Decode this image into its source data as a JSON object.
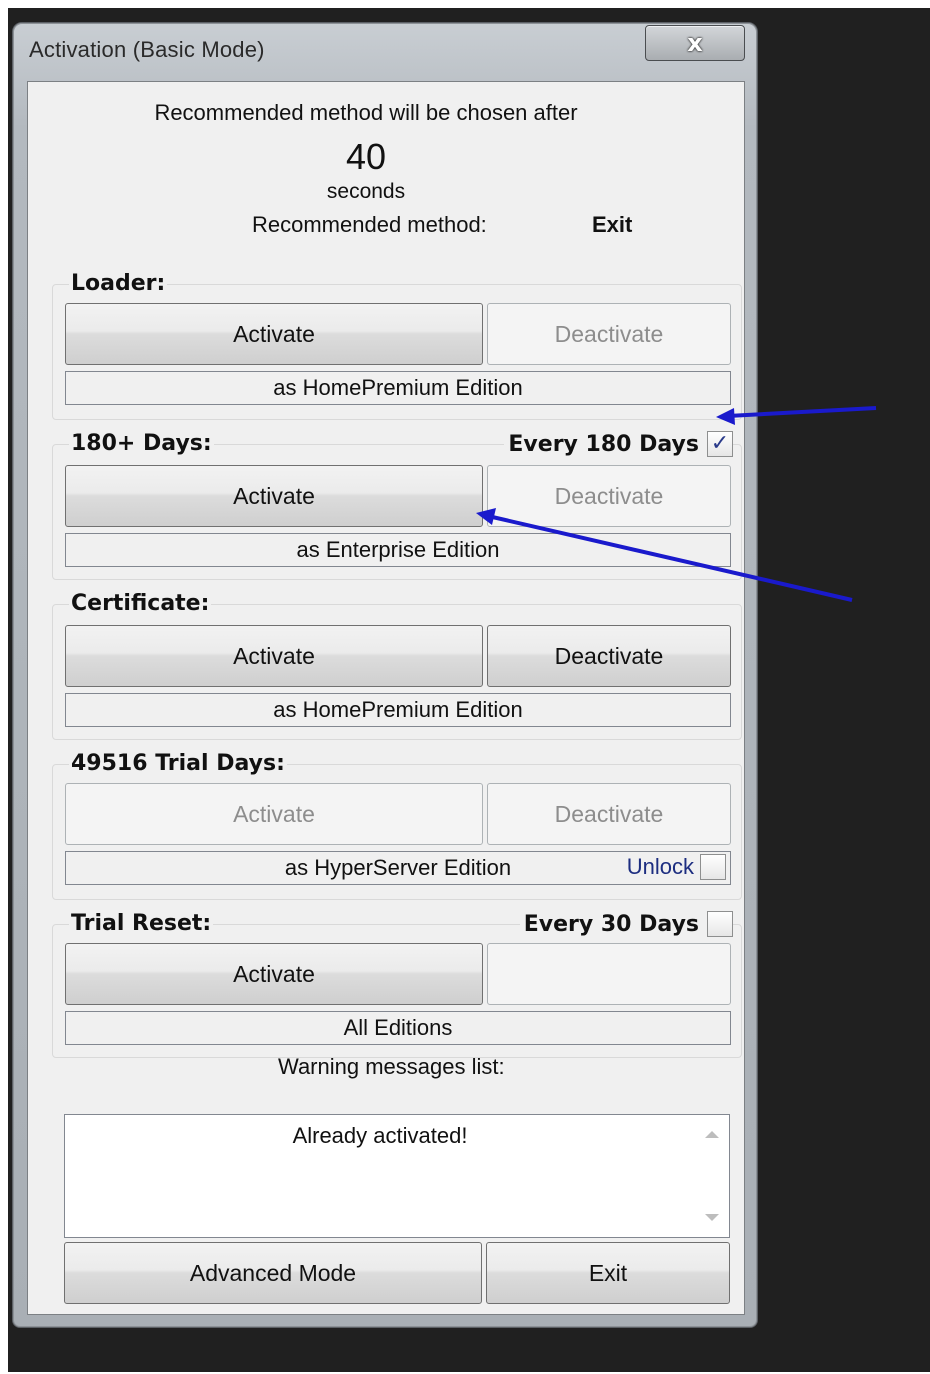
{
  "window": {
    "title": "Activation (Basic Mode)",
    "close_glyph": "x"
  },
  "header": {
    "recommend_text": "Recommended method will be chosen after",
    "countdown": "40",
    "countdown_unit": "seconds",
    "recommended_label": "Recommended method:",
    "recommended_value": "Exit"
  },
  "groups": [
    {
      "title": "Loader:",
      "activate_label": "Activate",
      "activate_enabled": true,
      "deactivate_label": "Deactivate",
      "deactivate_enabled": false,
      "edition": "as HomePremium Edition"
    },
    {
      "title": "180+ Days:",
      "option_label": "Every 180 Days",
      "option_checked": true,
      "activate_label": "Activate",
      "activate_enabled": true,
      "deactivate_label": "Deactivate",
      "deactivate_enabled": false,
      "edition": "as Enterprise Edition"
    },
    {
      "title": "Certificate:",
      "activate_label": "Activate",
      "activate_enabled": true,
      "deactivate_label": "Deactivate",
      "deactivate_enabled": true,
      "edition": "as HomePremium Edition"
    },
    {
      "title": "49516 Trial Days:",
      "activate_label": "Activate",
      "activate_enabled": false,
      "deactivate_label": "Deactivate",
      "deactivate_enabled": false,
      "edition": "as HyperServer Edition",
      "unlock_label": "Unlock",
      "unlock_checked": false
    },
    {
      "title": "Trial Reset:",
      "option_label": "Every 30 Days",
      "option_checked": false,
      "activate_label": "Activate",
      "activate_enabled": true,
      "deactivate_label": "",
      "deactivate_enabled": true,
      "edition": "All Editions"
    }
  ],
  "warnings": {
    "label": "Warning messages list:",
    "items": [
      "Already activated!"
    ]
  },
  "footer": {
    "advanced_label": "Advanced Mode",
    "exit_label": "Exit"
  },
  "colors": {
    "annotation_arrow": "#1a1acc",
    "check_mark": "#2a3a8a"
  },
  "icons": {
    "check": "✓"
  }
}
